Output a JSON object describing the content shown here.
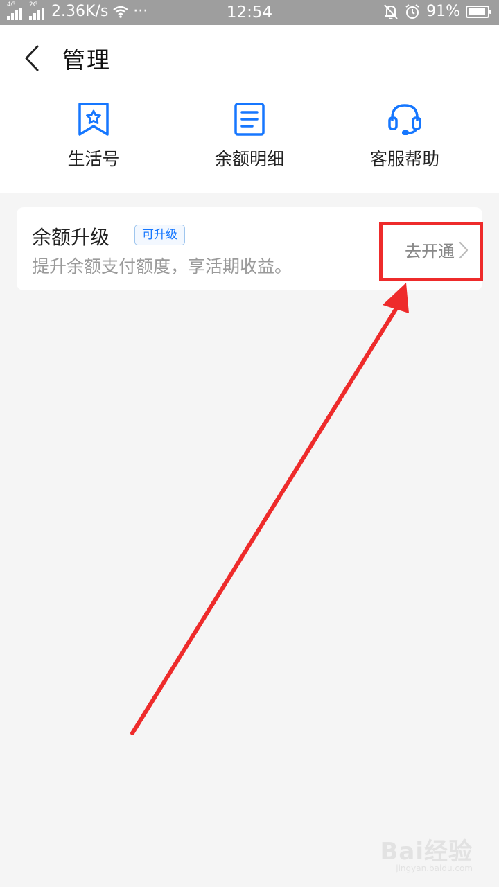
{
  "status_bar": {
    "net_label_1": "4G",
    "net_label_2": "2G",
    "speed": "2.36K/s",
    "more": "···",
    "time": "12:54",
    "battery": "91%",
    "battery_level": 0.91
  },
  "header": {
    "title": "管理"
  },
  "shortcuts": [
    {
      "label": "生活号",
      "icon": "bookmark-star-icon"
    },
    {
      "label": "余额明细",
      "icon": "document-list-icon"
    },
    {
      "label": "客服帮助",
      "icon": "headset-icon"
    }
  ],
  "card": {
    "title": "余额升级",
    "badge": "可升级",
    "description": "提升余额支付额度，享活期收益。",
    "action_label": "去开通"
  },
  "watermark": {
    "brand": "Bai经验",
    "url": "jingyan.baidu.com"
  },
  "colors": {
    "accent": "#1677ff",
    "annotation": "#ee2b2b",
    "status_bar": "#9e9e9e",
    "background": "#f5f5f5"
  }
}
